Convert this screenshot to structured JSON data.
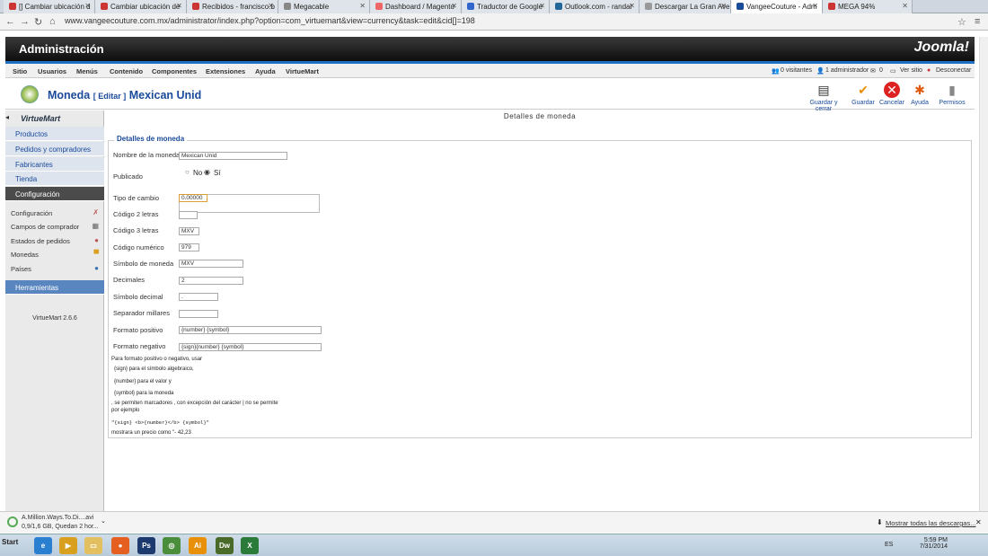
{
  "tabs": [
    {
      "label": "[] Cambiar ubicación d",
      "color": "#c33"
    },
    {
      "label": "Cambiar ubicación de",
      "color": "#c33"
    },
    {
      "label": "Recibidos - francisco.b",
      "color": "#c33"
    },
    {
      "label": "Megacable",
      "color": "#888"
    },
    {
      "label": "Dashboard / Magento",
      "color": "#e66"
    },
    {
      "label": "Traductor de Google",
      "color": "#36c"
    },
    {
      "label": "Outlook.com - randal",
      "color": "#269"
    },
    {
      "label": "Descargar La Gran Ave",
      "color": "#999"
    },
    {
      "label": "VangeeCouture - Adm",
      "color": "#1a4a9a"
    },
    {
      "label": "MEGA 94%",
      "color": "#c33"
    }
  ],
  "url": "www.vangeecouture.com.mx/administrator/index.php?option=com_virtuemart&view=currency&task=edit&cid[]=198",
  "header": {
    "title": "Administración",
    "logo": "Joomla!"
  },
  "menu": [
    "Sitio",
    "Usuarios",
    "Menús",
    "Contenido",
    "Componentes",
    "Extensiones",
    "Ayuda",
    "VirtueMart"
  ],
  "status": {
    "visitors": "0 visitantes",
    "admins": "1 administrador",
    "messages": "0",
    "view_site": "Ver sitio",
    "logout": "Desconectar"
  },
  "page": {
    "title": "Moneda",
    "edit": "[ Editar ]",
    "name": "Mexican Unid"
  },
  "toolbar": {
    "save_close": "Guardar y cerrar",
    "save": "Guardar",
    "cancel": "Cancelar",
    "help": "Ayuda",
    "permissions": "Permisos"
  },
  "sidebar": {
    "logo": "VirtueMart",
    "sections": [
      "Productos",
      "Pedidos y compradores",
      "Fabricantes",
      "Tienda",
      "Configuración"
    ],
    "subitems": [
      "Configuración",
      "Campos de comprador",
      "Estados de pedidos",
      "Monedas",
      "Países"
    ],
    "tools": "Herramientas",
    "version": "VirtueMart 2.6.6"
  },
  "form": {
    "heading": "Detalles de moneda",
    "legend": "Detalles de moneda",
    "name_label": "Nombre de la moneda",
    "name_value": "Mexican Unid",
    "published_label": "Publicado",
    "no": "No",
    "yes": "Sí",
    "rate_label": "Tipo de cambio",
    "rate_value": "0.00000",
    "code2_label": "Código 2 letras",
    "code2_value": "",
    "code3_label": "Código 3 letras",
    "code3_value": "MXV",
    "numcode_label": "Código numérico",
    "numcode_value": "979",
    "symbol_label": "Símbolo de moneda",
    "symbol_value": "MXV",
    "decimals_label": "Decimales",
    "decimals_value": "2",
    "decsym_label": "Símbolo decimal",
    "decsym_value": ".",
    "thousands_label": "Separador millares",
    "thousands_value": "",
    "positive_label": "Formato positivo",
    "positive_value": "{number} {symbol}",
    "negative_label": "Formato negativo",
    "negative_value": "{sign}{number} {symbol}",
    "notes": [
      "Para formato positivo o negativo, usar",
      "{sign} para el símbolo algebraico,",
      "{number} para el valor y",
      "{symbol} para la moneda",
      ", se permiten marcadores , con excepción del carácter | no se permite",
      "por ejemplo",
      "\"{sign} <b>{number}</b> {symbol}\"",
      "mostrara un precio como \"- 42,23"
    ]
  },
  "downloads": {
    "file": "A.Million.Ways.To.Di....avi",
    "progress": "0,9/1,6 GB, Quedan 2 hor...",
    "show_all": "Mostrar todas las descargas..."
  },
  "taskbar": {
    "start": "Start",
    "lang": "ES",
    "time": "5:59 PM",
    "date": "7/31/2014"
  }
}
